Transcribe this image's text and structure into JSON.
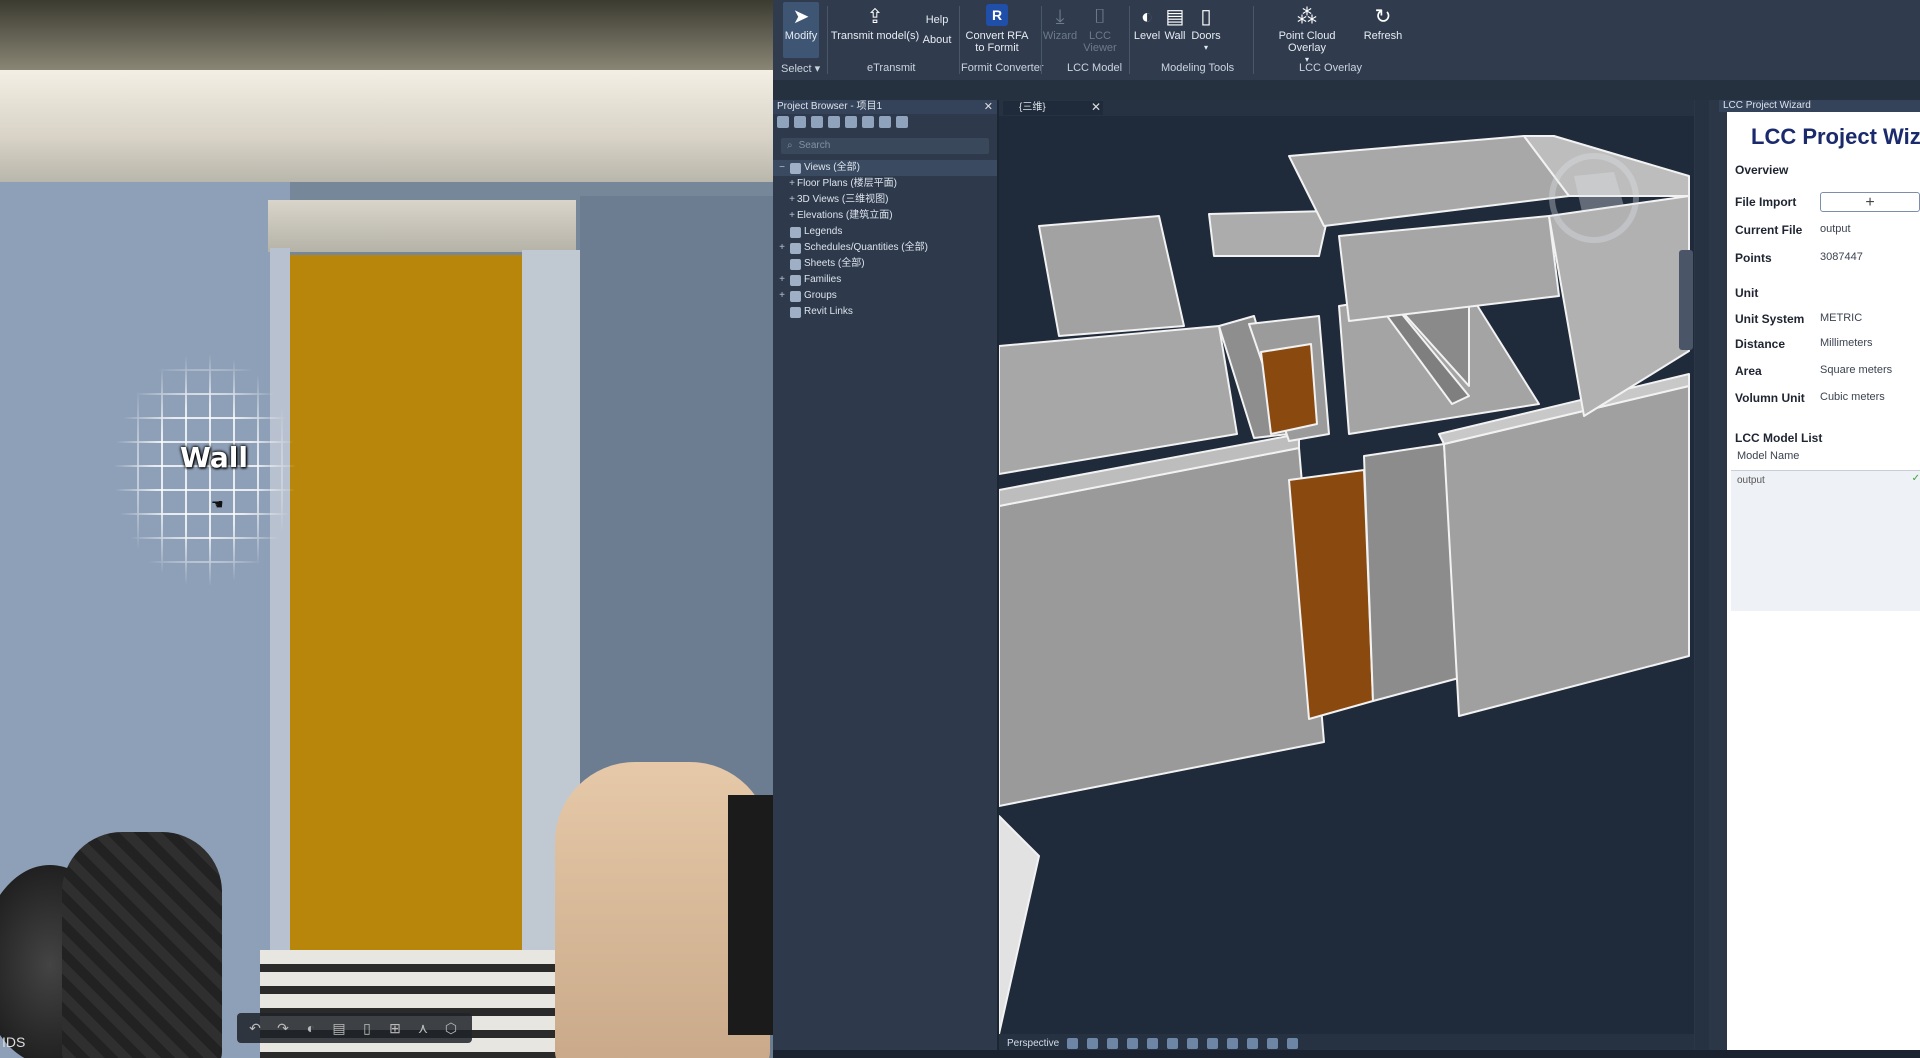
{
  "point_cloud": {
    "hover_label": "Wall",
    "corner_text": "IDS"
  },
  "ribbon": {
    "groups": [
      {
        "label": "Select",
        "buttons": [
          {
            "label": "Modify",
            "icon": "cursor-arrow-icon"
          }
        ]
      },
      {
        "label": "eTransmit",
        "buttons": [
          {
            "label": "Transmit model(s)",
            "icon": "transmit-icon"
          },
          {
            "label": "Help",
            "icon": "help-icon"
          },
          {
            "label": "About",
            "icon": "about-icon"
          }
        ]
      },
      {
        "label": "Formit Converter",
        "buttons": [
          {
            "label": "Convert RFA to Formit",
            "icon": "revit-r-icon"
          }
        ]
      },
      {
        "label": "LCC Model",
        "buttons": [
          {
            "label": "Wizard",
            "icon": "download-icon"
          },
          {
            "label": "LCC Viewer",
            "icon": "camera-icon"
          }
        ]
      },
      {
        "label": "Modeling Tools",
        "buttons": [
          {
            "label": "Level",
            "icon": "level-icon"
          },
          {
            "label": "Wall",
            "icon": "wall-icon"
          },
          {
            "label": "Doors",
            "icon": "door-icon"
          }
        ]
      },
      {
        "label": "LCC Overlay",
        "buttons": [
          {
            "label": "Point Cloud Overlay",
            "icon": "point-cloud-icon"
          },
          {
            "label": "Refresh",
            "icon": "refresh-icon"
          }
        ]
      }
    ]
  },
  "project_browser": {
    "title": "Project Browser - 项目1",
    "search_placeholder": "Search",
    "items": [
      {
        "label": "Views (全部)",
        "expander": "−",
        "level": 0
      },
      {
        "label": "Floor Plans (楼层平面)",
        "expander": "+",
        "level": 1
      },
      {
        "label": "3D Views (三维视图)",
        "expander": "+",
        "level": 1
      },
      {
        "label": "Elevations (建筑立面)",
        "expander": "+",
        "level": 1
      },
      {
        "label": "Legends",
        "expander": "",
        "level": 0
      },
      {
        "label": "Schedules/Quantities (全部)",
        "expander": "+",
        "level": 0
      },
      {
        "label": "Sheets (全部)",
        "expander": "",
        "level": 0
      },
      {
        "label": "Families",
        "expander": "+",
        "level": 0
      },
      {
        "label": "Groups",
        "expander": "+",
        "level": 0
      },
      {
        "label": "Revit Links",
        "expander": "",
        "level": 0
      }
    ]
  },
  "view": {
    "tab_title": "{三维}",
    "view_mode": "Perspective"
  },
  "wizard": {
    "panel_title": "LCC Project Wizard",
    "heading": "LCC Project Wizard",
    "overview_label": "Overview",
    "file_import_label": "File Import",
    "file_import_button": "+",
    "current_file_label": "Current File",
    "current_file_value": "output",
    "points_label": "Points",
    "points_value": "3087447",
    "unit_label": "Unit",
    "unit_system_label": "Unit System",
    "unit_system_value": "METRIC",
    "distance_label": "Distance",
    "distance_value": "Millimeters",
    "area_label": "Area",
    "area_value": "Square meters",
    "volume_label": "Volumn Unit",
    "volume_value": "Cubic meters",
    "model_list_label": "LCC Model List",
    "model_name_header": "Model Name",
    "models": [
      "output"
    ]
  },
  "colors": {
    "door_brown": "#8a4a0f",
    "wall_gray": "#9a9a9a",
    "wizard_heading": "#1a2a6c"
  }
}
